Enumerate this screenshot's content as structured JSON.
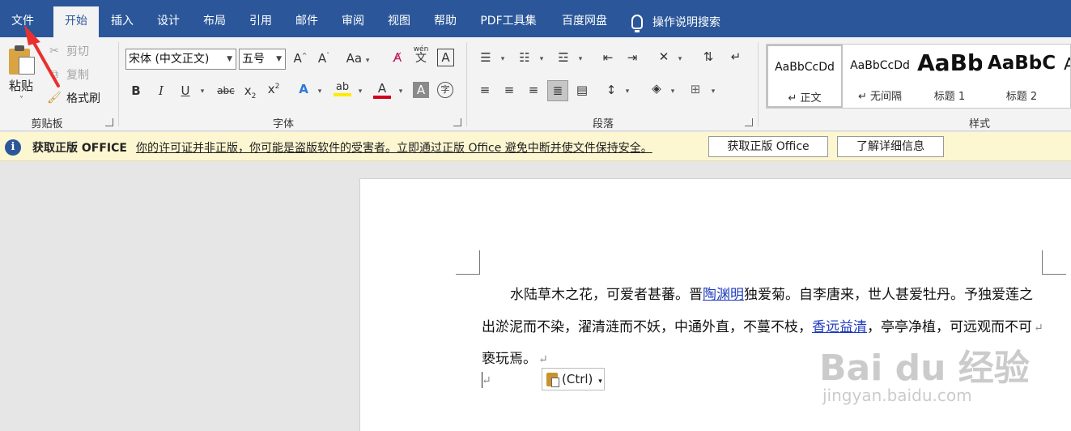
{
  "menu": {
    "file": "文件",
    "tabs": [
      "开始",
      "插入",
      "设计",
      "布局",
      "引用",
      "邮件",
      "审阅",
      "视图",
      "帮助",
      "PDF工具集",
      "百度网盘"
    ],
    "active_tab": "开始",
    "search": "操作说明搜索"
  },
  "clipboard": {
    "paste": "粘贴",
    "cut": "剪切",
    "copy": "复制",
    "format_painter": "格式刷",
    "group_label": "剪贴板"
  },
  "font": {
    "font_name": "宋体 (中文正文)",
    "font_size": "五号",
    "group_label": "字体",
    "phonetic_top": "wén",
    "phonetic_bottom": "文",
    "aa": "Aa"
  },
  "paragraph": {
    "group_label": "段落"
  },
  "styles": {
    "group_label": "样式",
    "items": [
      {
        "sample": "AaBbCcDd",
        "name": "↵ 正文"
      },
      {
        "sample": "AaBbCcDd",
        "name": "↵ 无间隔"
      },
      {
        "sample": "AaBb",
        "name": "标题 1"
      },
      {
        "sample": "AaBbC",
        "name": "标题 2"
      },
      {
        "sample": "A",
        "name": ""
      }
    ]
  },
  "infobar": {
    "title": "获取正版 OFFICE",
    "message": "你的许可证并非正版，你可能是盗版软件的受害者。立即通过正版 Office 避免中断并使文件保持安全。",
    "btn_genuine": "获取正版 Office",
    "btn_learn": "了解详细信息"
  },
  "document": {
    "line1_a": "水陆草木之花，可爱者甚蕃。晋",
    "line1_link": "陶渊明",
    "line1_b": "独爱菊。自李唐来，世人甚爱牡丹。予独爱莲之",
    "line2_a": "出淤泥而不染，濯清涟而不妖，中通外直，不蔓不枝，",
    "line2_link": "香远益清",
    "line2_b": "，亭亭净植，可远观而不可",
    "line3": "亵玩焉。",
    "para_mark": "↵",
    "paste_options": "(Ctrl)"
  },
  "watermark": {
    "logo": "Bai du 经验",
    "url": "jingyan.baidu.com"
  },
  "colors": {
    "titlebar": "#2b579a",
    "ribbon": "#f3f3f3",
    "infobar": "#fcf6d1",
    "link": "#1f3bbf",
    "annotation": "#e8312f"
  }
}
